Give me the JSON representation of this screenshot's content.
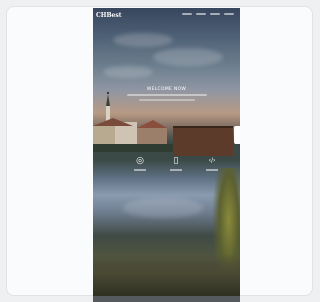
{
  "site": {
    "logo": "CHBest",
    "nav_links": [
      "",
      "",
      "",
      ""
    ]
  },
  "hero": {
    "title": "WELCOME NOW"
  },
  "features": [
    {
      "icon": "globe-icon",
      "symbol": "◎"
    },
    {
      "icon": "mobile-icon",
      "symbol": "▯"
    },
    {
      "icon": "code-icon",
      "symbol": "‹/›"
    }
  ],
  "colors": {
    "card_background": "#fafbfc",
    "page_background": "#eef0f2",
    "bridge_roof": "#5c3b2a"
  }
}
